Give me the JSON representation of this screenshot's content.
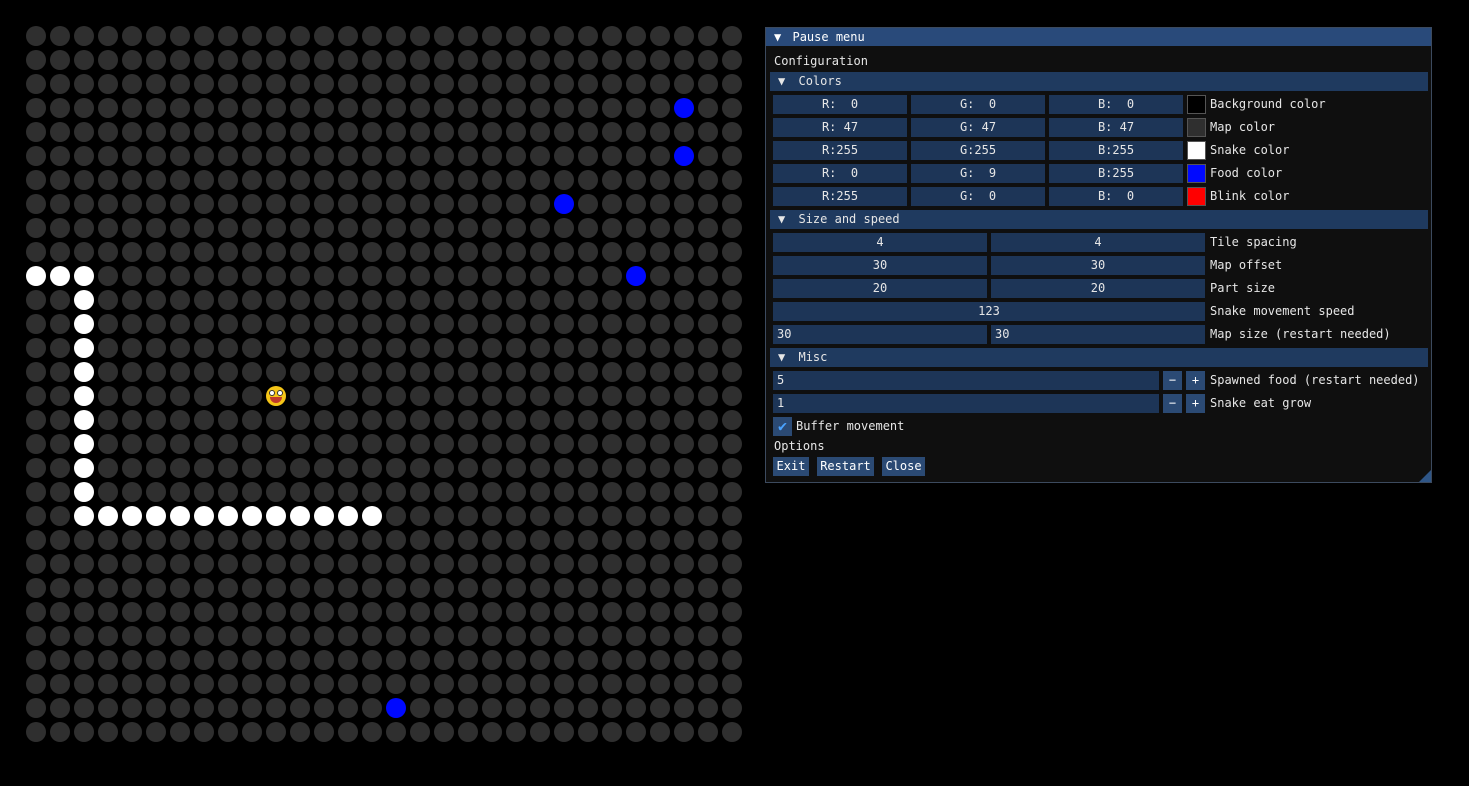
{
  "colors": {
    "background": "#000000",
    "map": "#2f2f2f",
    "snake": "#ffffff",
    "food": "#0009ff",
    "blink": "#ff0000"
  },
  "game": {
    "grid_size": 30,
    "snake_body": [
      [
        14,
        20
      ],
      [
        13,
        20
      ],
      [
        12,
        20
      ],
      [
        11,
        20
      ],
      [
        10,
        20
      ],
      [
        9,
        20
      ],
      [
        8,
        20
      ],
      [
        7,
        20
      ],
      [
        6,
        20
      ],
      [
        5,
        20
      ],
      [
        4,
        20
      ],
      [
        3,
        20
      ],
      [
        2,
        20
      ],
      [
        2,
        19
      ],
      [
        2,
        18
      ],
      [
        2,
        17
      ],
      [
        2,
        16
      ],
      [
        2,
        15
      ],
      [
        2,
        14
      ],
      [
        2,
        13
      ],
      [
        2,
        12
      ],
      [
        2,
        11
      ],
      [
        2,
        10
      ],
      [
        1,
        10
      ],
      [
        0,
        10
      ]
    ],
    "snake_tail": [],
    "head": [
      10,
      15
    ],
    "food": [
      [
        15,
        28
      ],
      [
        22,
        7
      ],
      [
        25,
        10
      ],
      [
        27,
        3
      ],
      [
        27,
        5
      ]
    ]
  },
  "pause_menu": {
    "title": "Pause menu",
    "configuration_label": "Configuration",
    "colors_header": "Colors",
    "color_rows": [
      {
        "r": "R:  0",
        "g": "G:  0",
        "b": "B:  0",
        "swatch": "#000000",
        "label": "Background color"
      },
      {
        "r": "R: 47",
        "g": "G: 47",
        "b": "B: 47",
        "swatch": "#2f2f2f",
        "label": "Map color"
      },
      {
        "r": "R:255",
        "g": "G:255",
        "b": "B:255",
        "swatch": "#ffffff",
        "label": "Snake color"
      },
      {
        "r": "R:  0",
        "g": "G:  9",
        "b": "B:255",
        "swatch": "#0009ff",
        "label": "Food color"
      },
      {
        "r": "R:255",
        "g": "G:  0",
        "b": "B:  0",
        "swatch": "#ff0000",
        "label": "Blink color"
      }
    ],
    "size_header": "Size and speed",
    "tile_spacing": {
      "a": "4",
      "b": "4",
      "label": "Tile spacing"
    },
    "map_offset": {
      "a": "30",
      "b": "30",
      "label": "Map offset"
    },
    "part_size": {
      "a": "20",
      "b": "20",
      "label": "Part size"
    },
    "movement_speed": {
      "value": "123",
      "label": "Snake movement speed"
    },
    "map_size": {
      "a": "30",
      "b": "30",
      "label": "Map size (restart needed)"
    },
    "misc_header": "Misc",
    "spawned_food": {
      "value": "5",
      "label": "Spawned food (restart needed)"
    },
    "eat_grow": {
      "value": "1",
      "label": "Snake eat grow"
    },
    "buffer_movement": {
      "checked": true,
      "label": "Buffer movement"
    },
    "options_label": "Options",
    "buttons": {
      "exit": "Exit",
      "restart": "Restart",
      "close": "Close"
    },
    "arrow": "▼",
    "minus": "−",
    "plus": "+",
    "check": "✔"
  }
}
